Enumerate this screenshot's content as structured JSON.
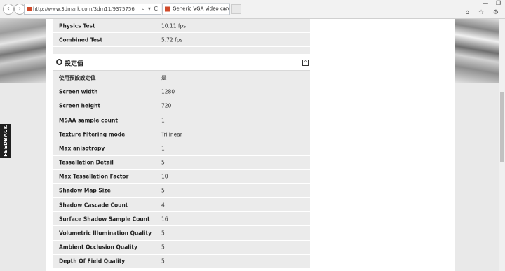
{
  "browser": {
    "address": "http://www.3dmark.com/3dm11/9375756",
    "address_controls": "⌕ ▾ C",
    "tab_title": "Generic VGA video card b...",
    "tab_close": "×",
    "window_controls": "— ❐",
    "tools": "⌂ ☆ ⚙"
  },
  "feedback": {
    "label": "FEEDBACK"
  },
  "top_rows": [
    {
      "key": "Physics Test",
      "value": "10.11 fps"
    },
    {
      "key": "Combined Test",
      "value": "5.72 fps"
    }
  ],
  "settings": {
    "title": "設定值",
    "collapse_symbol": "^",
    "rows": [
      {
        "key": "使用預設設定值",
        "value": "是"
      },
      {
        "key": "Screen width",
        "value": "1280"
      },
      {
        "key": "Screen height",
        "value": "720"
      },
      {
        "key": "MSAA sample count",
        "value": "1"
      },
      {
        "key": "Texture filtering mode",
        "value": "Trilinear"
      },
      {
        "key": "Max anisotropy",
        "value": "1"
      },
      {
        "key": "Tessellation Detail",
        "value": "5"
      },
      {
        "key": "Max Tessellation Factor",
        "value": "10"
      },
      {
        "key": "Shadow Map Size",
        "value": "5"
      },
      {
        "key": "Shadow Cascade Count",
        "value": "4"
      },
      {
        "key": "Surface Shadow Sample Count",
        "value": "16"
      },
      {
        "key": "Volumetric Illumination Quality",
        "value": "5"
      },
      {
        "key": "Ambient Occlusion Quality",
        "value": "5"
      },
      {
        "key": "Depth Of Field Quality",
        "value": "5"
      }
    ]
  }
}
